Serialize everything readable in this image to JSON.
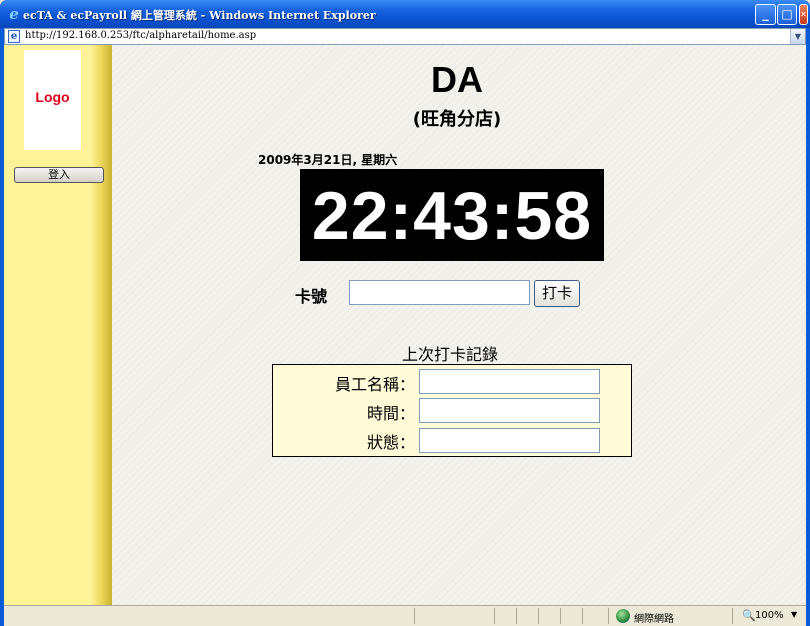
{
  "window": {
    "title": "ecTA & ecPayroll 網上管理系統 - Windows Internet Explorer",
    "ie_glyph": "e",
    "minimize_glyph": "_",
    "maximize_glyph": "□",
    "close_glyph": "✕"
  },
  "address_bar": {
    "url": "http://192.168.0.253/ftc/alpharetail/home.asp",
    "dropdown_glyph": "▼"
  },
  "sidebar": {
    "logo_text": "Logo",
    "login_label": "登入"
  },
  "main": {
    "shop_name": "DA",
    "branch": "(旺角分店)",
    "date": "2009年3月21日, 星期六",
    "clock": "22:43:58",
    "card_label": "卡號",
    "card_input_value": "",
    "punch_button": "打卡",
    "last_record_title": "上次打卡記錄",
    "record_fields": [
      {
        "label": "員工名稱：",
        "value": ""
      },
      {
        "label": "時間：",
        "value": ""
      },
      {
        "label": "狀態：",
        "value": ""
      }
    ]
  },
  "status_bar": {
    "zone": "網際網路",
    "zoom_glyph": "🔍",
    "zoom": "100%",
    "zoom_dropdown_glyph": "▼"
  },
  "colors": {
    "titlebar": "#0b52cf",
    "sidebar": "#fff39a",
    "logo_text": "#e0001a",
    "clock_bg": "#000000",
    "record_box_bg": "#fffbd8"
  }
}
